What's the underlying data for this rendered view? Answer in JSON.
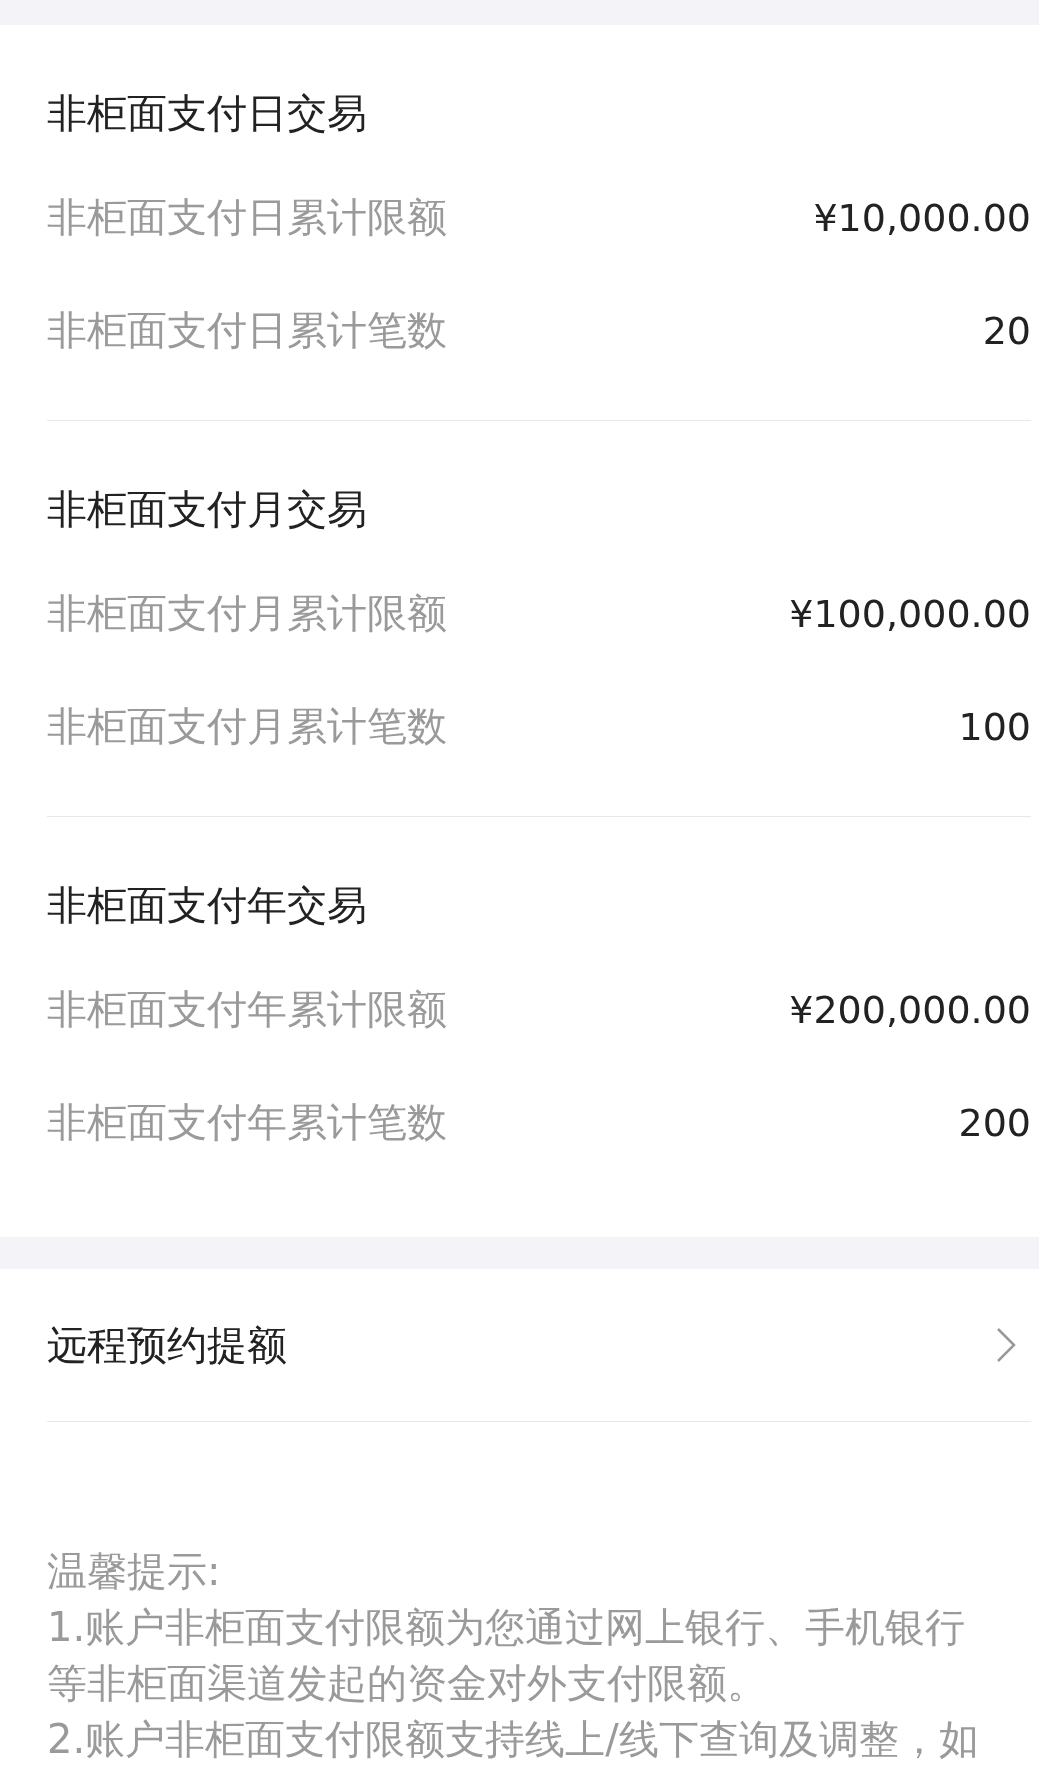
{
  "limit_sections": [
    {
      "title": "非柜面支付日交易",
      "rows": [
        {
          "label": "非柜面支付日累计限额",
          "value": "¥10,000.00"
        },
        {
          "label": "非柜面支付日累计笔数",
          "value": "20"
        }
      ]
    },
    {
      "title": "非柜面支付月交易",
      "rows": [
        {
          "label": "非柜面支付月累计限额",
          "value": "¥100,000.00"
        },
        {
          "label": "非柜面支付月累计笔数",
          "value": "100"
        }
      ]
    },
    {
      "title": "非柜面支付年交易",
      "rows": [
        {
          "label": "非柜面支付年累计限额",
          "value": "¥200,000.00"
        },
        {
          "label": "非柜面支付年累计笔数",
          "value": "200"
        }
      ]
    }
  ],
  "menu_item": {
    "label": "远程预约提额"
  },
  "tips": {
    "title": "温馨提示:",
    "items": [
      "1.账户非柜面支付限额为您通过网上银行、手机银行等非柜面渠道发起的资金对外支付限额。",
      "2.账户非柜面支付限额支持线上/线下查询及调整，如"
    ]
  }
}
